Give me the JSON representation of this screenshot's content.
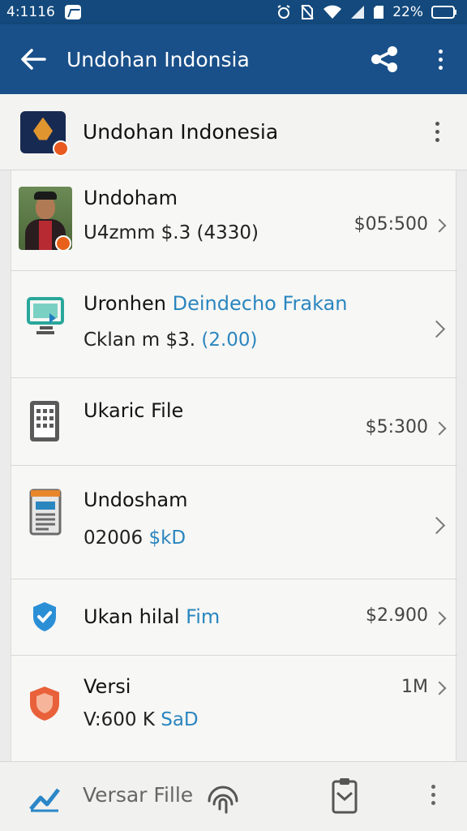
{
  "status_bar": {
    "time": "4:1116",
    "battery": "22%"
  },
  "toolbar": {
    "title": "Undohan Indonsia",
    "back_icon": "arrow-left-icon",
    "share_icon": "share-icon",
    "more_icon": "more-vertical-icon"
  },
  "app_header": {
    "name": "Undohan Indonesia"
  },
  "rows": [
    {
      "title": "Undoham",
      "subtitle": "U4zmm $.3 (4330)",
      "price": "$05:500"
    },
    {
      "title_a": "Uronhen ",
      "title_b": "Deindecho Frakan",
      "subtitle_a": "Cklan m $3. ",
      "subtitle_b": "(2.00)",
      "price": ""
    },
    {
      "title": "Ukaric File",
      "price": "$5:300"
    },
    {
      "title": "Undosham",
      "subtitle_a": "02006 ",
      "subtitle_b": "$kD",
      "price": ""
    },
    {
      "title_a": "Ukan hilal ",
      "title_b": "Fim",
      "price": "$2.900"
    },
    {
      "title": "Versi",
      "subtitle_a": "V:600 K ",
      "subtitle_b": "SaD",
      "price": "1M"
    }
  ],
  "bottom_bar": {
    "label": "Versar Fille"
  },
  "colors": {
    "toolbar": "#1a5089",
    "accent_blue": "#2a86bf",
    "shield_orange": "#e8613a",
    "shield_blue": "#2b8fd6"
  }
}
